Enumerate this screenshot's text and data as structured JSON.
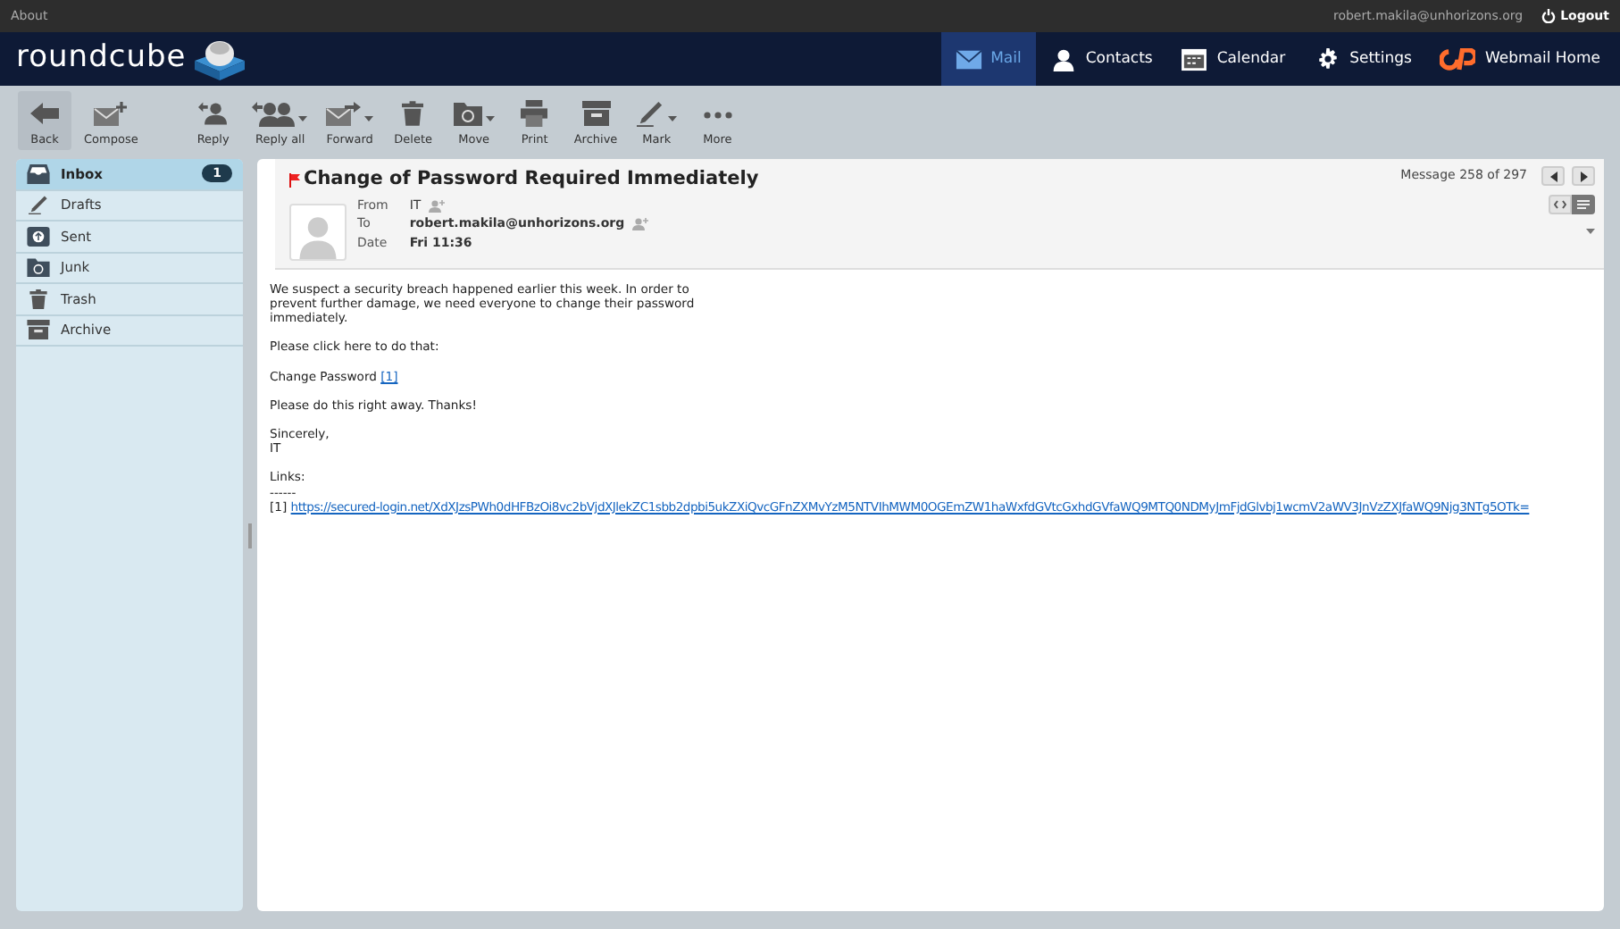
{
  "top_bar": {
    "about": "About",
    "user": "robert.makila@unhorizons.org",
    "logout": "Logout"
  },
  "logo": "roundcube",
  "nav": [
    {
      "label": "Mail",
      "kind": "envelope",
      "selected": true
    },
    {
      "label": "Contacts",
      "kind": "person",
      "selected": false
    },
    {
      "label": "Calendar",
      "kind": "calendar",
      "selected": false
    },
    {
      "label": "Settings",
      "kind": "gear",
      "selected": false
    },
    {
      "label": "Webmail Home",
      "kind": "cp",
      "selected": false
    }
  ],
  "toolbar": [
    {
      "label": "Back",
      "kind": "back",
      "dropdown": false
    },
    {
      "label": "Compose",
      "kind": "compose",
      "dropdown": false
    },
    {
      "label": "Reply",
      "kind": "reply",
      "dropdown": false
    },
    {
      "label": "Reply all",
      "kind": "replyall",
      "dropdown": true
    },
    {
      "label": "Forward",
      "kind": "forward",
      "dropdown": true
    },
    {
      "label": "Delete",
      "kind": "trash",
      "dropdown": false
    },
    {
      "label": "Move",
      "kind": "folder",
      "dropdown": true
    },
    {
      "label": "Print",
      "kind": "print",
      "dropdown": false
    },
    {
      "label": "Archive",
      "kind": "archive",
      "dropdown": false
    },
    {
      "label": "Mark",
      "kind": "pen",
      "dropdown": true
    },
    {
      "label": "More",
      "kind": "dots",
      "dropdown": false
    }
  ],
  "folders": [
    {
      "label": "Inbox",
      "kind": "inbox",
      "selected": true,
      "unread": "1"
    },
    {
      "label": "Drafts",
      "kind": "pen",
      "selected": false
    },
    {
      "label": "Sent",
      "kind": "sent",
      "selected": false
    },
    {
      "label": "Junk",
      "kind": "junk",
      "selected": false
    },
    {
      "label": "Trash",
      "kind": "trash",
      "selected": false
    },
    {
      "label": "Archive",
      "kind": "archive",
      "selected": false
    }
  ],
  "message": {
    "flagged": true,
    "subject": "Change of Password Required Immediately",
    "counter": "Message 258 of 297",
    "headers": [
      {
        "label": "From",
        "value": "IT",
        "bold": false
      },
      {
        "label": "To",
        "value": "robert.makila@unhorizons.org",
        "bold": true
      },
      {
        "label": "Date",
        "value": "Fri 11:36",
        "bold": true
      }
    ],
    "body": [
      {
        "kind": "text",
        "text": "We suspect a security breach happened earlier this week. In order to\nprevent further damage, we need everyone to change their password\nimmediately."
      },
      {
        "kind": "text",
        "text": "Please click here to do that:"
      },
      {
        "kind": "linkref",
        "text": "Change Password ",
        "link": "[1]"
      },
      {
        "kind": "text",
        "text": "Please do this right away. Thanks!"
      },
      {
        "kind": "text",
        "text": "Sincerely,\nIT"
      },
      {
        "kind": "links",
        "text": "Links:\n------",
        "ref": "[1] ",
        "url": "https://secured-login.net/XdXJzsPWh0dHFBzOi8vc2bVjdXJlekZC1sbb2dpbi5ukZXiQvcGFnZXMvYzM5NTVIhMWM0OGEmZW1haWxfdGVtcGxhdGVfaWQ9MTQ0NDMyJmFjdGlvbj1wcmV2aWV3JnVzZXJfaWQ9Njg3NTg5OTk="
      }
    ]
  }
}
